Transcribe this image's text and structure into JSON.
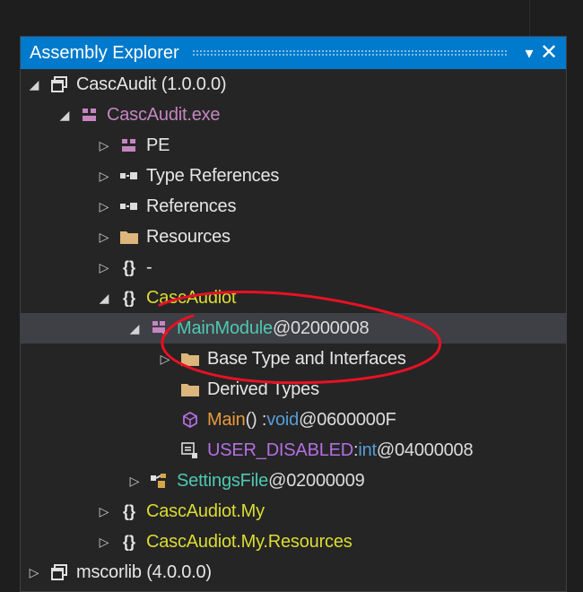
{
  "window": {
    "title": "Assembly Explorer",
    "menu_icon": "dropdown-arrow",
    "close_icon": "close"
  },
  "tree": [
    {
      "expander": "expanded",
      "icon": "assembly-icon",
      "parts": [
        {
          "text": "CascAudit (1.0.0.0)"
        }
      ]
    },
    {
      "expander": "expanded",
      "icon": "module-icon",
      "parts": [
        {
          "text": "CascAudit.exe"
        }
      ]
    },
    {
      "expander": "collapsed",
      "icon": "pe-icon",
      "parts": [
        {
          "text": "PE"
        }
      ]
    },
    {
      "expander": "collapsed",
      "icon": "references-icon",
      "parts": [
        {
          "text": "Type References"
        }
      ]
    },
    {
      "expander": "collapsed",
      "icon": "references-icon",
      "parts": [
        {
          "text": "References"
        }
      ]
    },
    {
      "expander": "collapsed",
      "icon": "folder-icon",
      "parts": [
        {
          "text": "Resources"
        }
      ]
    },
    {
      "expander": "collapsed",
      "icon": "namespace-icon",
      "parts": [
        {
          "text": "-"
        }
      ]
    },
    {
      "expander": "expanded",
      "icon": "namespace-icon",
      "parts": [
        {
          "text": "CascAudiot"
        }
      ]
    },
    {
      "expander": "expanded",
      "icon": "class-icon",
      "parts": [
        {
          "text": "MainModule"
        },
        {
          "text": " @02000008"
        }
      ]
    },
    {
      "expander": "collapsed",
      "icon": "folder-icon",
      "parts": [
        {
          "text": "Base Type and Interfaces"
        }
      ]
    },
    {
      "expander": "",
      "icon": "folder-icon",
      "parts": [
        {
          "text": "Derived Types"
        }
      ]
    },
    {
      "expander": "",
      "icon": "method-icon",
      "parts": [
        {
          "text": "Main"
        },
        {
          "text": "() : "
        },
        {
          "text": "void"
        },
        {
          "text": " @0600000F"
        }
      ]
    },
    {
      "expander": "",
      "icon": "field-icon",
      "parts": [
        {
          "text": "USER_DISABLED"
        },
        {
          "text": " : "
        },
        {
          "text": "int"
        },
        {
          "text": " @04000008"
        }
      ]
    },
    {
      "expander": "collapsed",
      "icon": "class-settings-icon",
      "parts": [
        {
          "text": "SettingsFile"
        },
        {
          "text": " @02000009"
        }
      ]
    },
    {
      "expander": "collapsed",
      "icon": "namespace-icon",
      "parts": [
        {
          "text": "CascAudiot.My"
        }
      ]
    },
    {
      "expander": "collapsed",
      "icon": "namespace-icon",
      "parts": [
        {
          "text": "CascAudiot.My.Resources"
        }
      ]
    },
    {
      "expander": "collapsed",
      "icon": "assembly-icon",
      "parts": [
        {
          "text": "mscorlib (4.0.0.0)"
        }
      ]
    }
  ],
  "colors": {
    "title_bar": "#007acc",
    "background": "#252526",
    "selection": "#3f3f46",
    "annotation": "#e81123"
  }
}
